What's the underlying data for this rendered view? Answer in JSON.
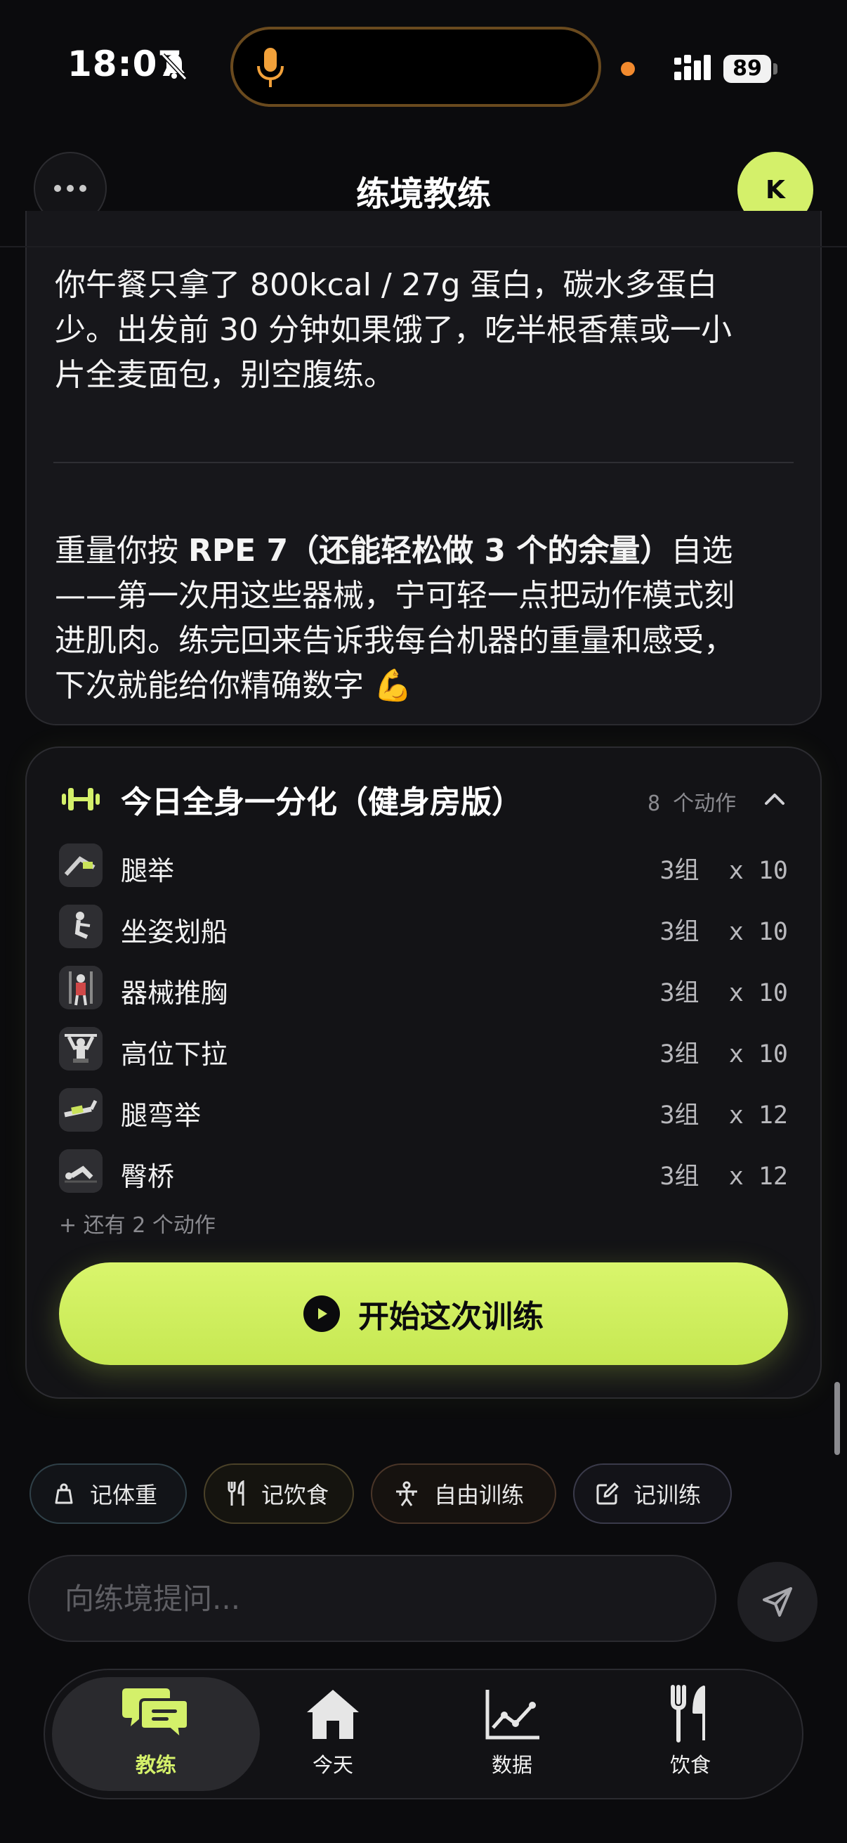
{
  "status_bar": {
    "time": "18:07",
    "battery": "89"
  },
  "header": {
    "title": "练境教练",
    "avatar_initial": "K"
  },
  "message": {
    "para1_lines": [
      "你午餐只拿了 800kcal / 27g 蛋白，碳水多蛋白",
      "少。出发前 30 分钟如果饿了，吃半根香蕉或一小",
      "片全麦面包，别空腹练。"
    ],
    "para2": {
      "prefix": "重量你按 ",
      "bold": "RPE 7（还能轻松做 3 个的余量）",
      "suffix": "自选",
      "lines": [
        "——第一次用这些器械，宁可轻一点把动作模式刻",
        "进肌肉。练完回来告诉我每台机器的重量和感受，",
        "下次就能给你精确数字 💪"
      ]
    }
  },
  "workout": {
    "title": "今日全身一分化（健身房版）",
    "count": "8 个动作",
    "exercises": [
      {
        "name": "腿举",
        "sets": "3组  x 10"
      },
      {
        "name": "坐姿划船",
        "sets": "3组  x 10"
      },
      {
        "name": "器械推胸",
        "sets": "3组  x 10"
      },
      {
        "name": "高位下拉",
        "sets": "3组  x 10"
      },
      {
        "name": "腿弯举",
        "sets": "3组  x 12"
      },
      {
        "name": "臀桥",
        "sets": "3组  x 12"
      }
    ],
    "more": "+ 还有 2 个动作",
    "start_label": "开始这次训练"
  },
  "quick_actions": {
    "weight": "记体重",
    "food": "记饮食",
    "free_training": "自由训练",
    "log_training": "记训练"
  },
  "composer": {
    "placeholder": "向练境提问..."
  },
  "tabs": [
    {
      "label": "教练",
      "active": true
    },
    {
      "label": "今天",
      "active": false
    },
    {
      "label": "数据",
      "active": false
    },
    {
      "label": "饮食",
      "active": false
    }
  ],
  "colors": {
    "accent": "#d4f06a",
    "background": "#0b0b0d",
    "card": "#17171b"
  }
}
